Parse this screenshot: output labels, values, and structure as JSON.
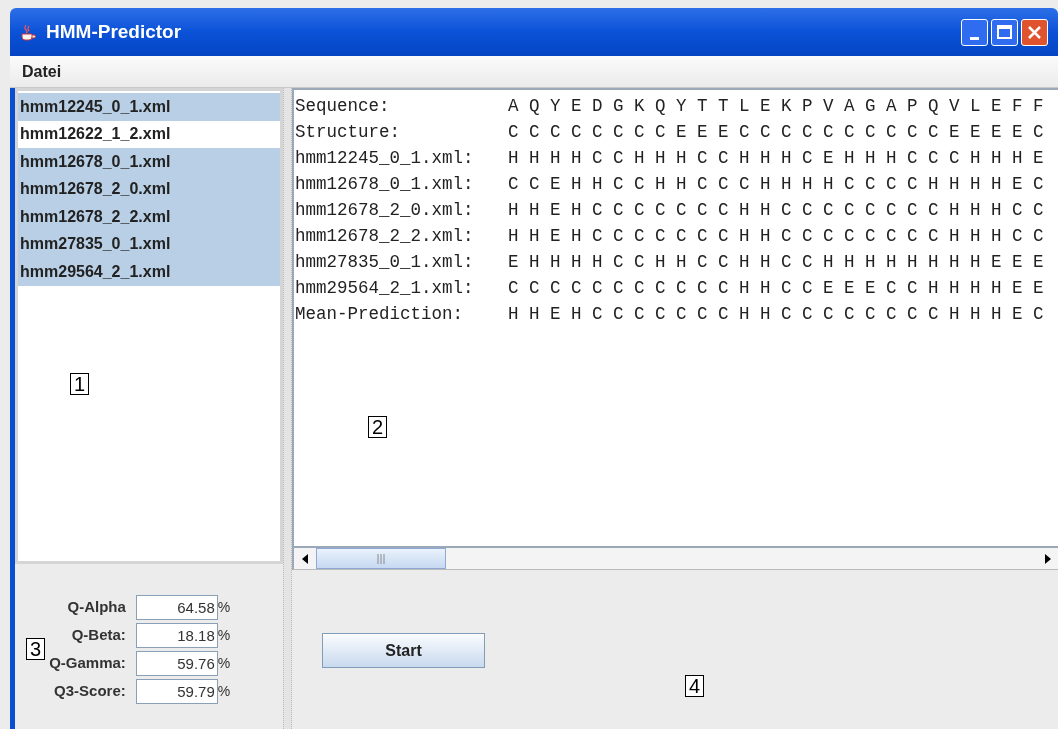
{
  "window": {
    "title": "HMM-Predictor"
  },
  "menu": [
    "Datei"
  ],
  "file_list": [
    {
      "label": "hmm12245_0_1.xml",
      "selected": true
    },
    {
      "label": "hmm12622_1_2.xml",
      "selected": false
    },
    {
      "label": "hmm12678_0_1.xml",
      "selected": true
    },
    {
      "label": "hmm12678_2_0.xml",
      "selected": true
    },
    {
      "label": "hmm12678_2_2.xml",
      "selected": true
    },
    {
      "label": "hmm27835_0_1.xml",
      "selected": true
    },
    {
      "label": "hmm29564_2_1.xml",
      "selected": true
    }
  ],
  "alignment": [
    {
      "label": "Sequence:",
      "sequence": "A Q Y E D G K Q Y T T L E K P V A G A P Q V L E F F"
    },
    {
      "label": "Structure:",
      "sequence": "C C C C C C C C E E E C C C C C C C C C C E E E E C"
    },
    {
      "label": "hmm12245_0_1.xml:",
      "sequence": "H H H H C C H H H C C H H H C E H H H C C C H H H E"
    },
    {
      "label": "hmm12678_0_1.xml:",
      "sequence": "C C E H H C C H H C C C H H H H C C C C H H H H E C"
    },
    {
      "label": "hmm12678_2_0.xml:",
      "sequence": "H H E H C C C C C C C H H C C C C C C C C H H H C C"
    },
    {
      "label": "hmm12678_2_2.xml:",
      "sequence": "H H E H C C C C C C C H H C C C C C C C C H H H C C"
    },
    {
      "label": "hmm27835_0_1.xml:",
      "sequence": "E H H H H C C H H C C H H C C H H H H H H H H E E E"
    },
    {
      "label": "hmm29564_2_1.xml:",
      "sequence": "C C C C C C C C C C C H H C C E E E C C H H H H E E"
    },
    {
      "label": "Mean-Prediction:",
      "sequence": "H H E H C C C C C C C H H C C C C C C C C H H H E C"
    }
  ],
  "scores": [
    {
      "label": "Q-Alpha",
      "value": "64.58",
      "unit": "%"
    },
    {
      "label": "Q-Beta:",
      "value": "18.18",
      "unit": "%"
    },
    {
      "label": "Q-Gamma:",
      "value": "59.76",
      "unit": "%"
    },
    {
      "label": "Q3-Score:",
      "value": "59.79",
      "unit": "%"
    }
  ],
  "start_button": "Start",
  "region_markers": [
    "1",
    "2",
    "3",
    "4"
  ]
}
